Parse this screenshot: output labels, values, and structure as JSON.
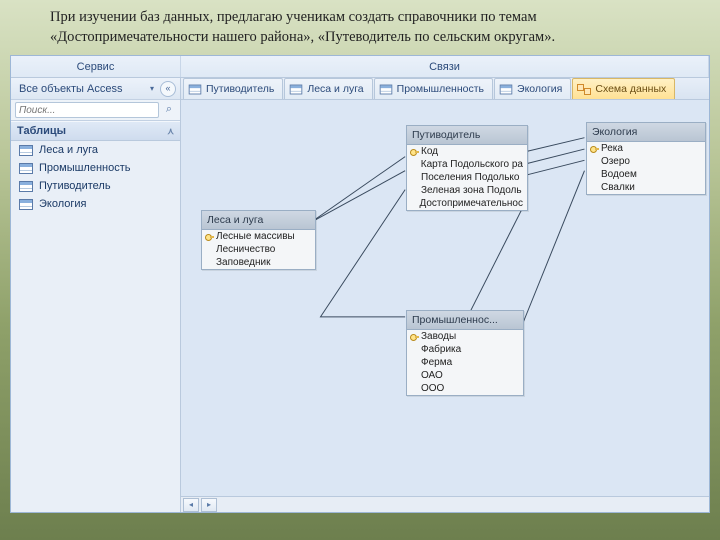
{
  "page_text": "При изучении баз данных, предлагаю ученикам создать справочники по темам «Достопримечательности нашего района», «Путеводитель по сельским округам».",
  "ribbon": {
    "left": "Сервис",
    "right": "Связи"
  },
  "nav": {
    "title": "Все объекты Access",
    "collapse_glyph": "«",
    "search_placeholder": "Поиск...",
    "group": "Таблицы",
    "items": [
      {
        "label": "Леса и луга"
      },
      {
        "label": "Промышленность"
      },
      {
        "label": "Путиводитель"
      },
      {
        "label": "Экология"
      }
    ]
  },
  "tabs": [
    {
      "label": "Путиводитель",
      "type": "table"
    },
    {
      "label": "Леса и луга",
      "type": "table"
    },
    {
      "label": "Промышленность",
      "type": "table"
    },
    {
      "label": "Экология",
      "type": "table"
    },
    {
      "label": "Схема данных",
      "type": "rel",
      "active": true
    }
  ],
  "boxes": {
    "lesa": {
      "title": "Леса и луга",
      "fields": [
        {
          "n": "Лесные массивы",
          "k": true
        },
        {
          "n": "Лесничество"
        },
        {
          "n": "Заповедник"
        }
      ]
    },
    "putev": {
      "title": "Путиводитель",
      "fields": [
        {
          "n": "Код",
          "k": true
        },
        {
          "n": "Карта Подольского ра"
        },
        {
          "n": "Поселения Подолько"
        },
        {
          "n": "Зеленая зона Подоль"
        },
        {
          "n": "Достопримечательнос"
        }
      ]
    },
    "prom": {
      "title": "Промышленнос...",
      "fields": [
        {
          "n": "Заводы",
          "k": true
        },
        {
          "n": "Фабрика"
        },
        {
          "n": "Ферма"
        },
        {
          "n": "ОАО"
        },
        {
          "n": "ООО"
        }
      ]
    },
    "eco": {
      "title": "Экология",
      "fields": [
        {
          "n": "Река",
          "k": true
        },
        {
          "n": "Озеро"
        },
        {
          "n": "Водоем"
        },
        {
          "n": "Свалки"
        }
      ]
    }
  }
}
